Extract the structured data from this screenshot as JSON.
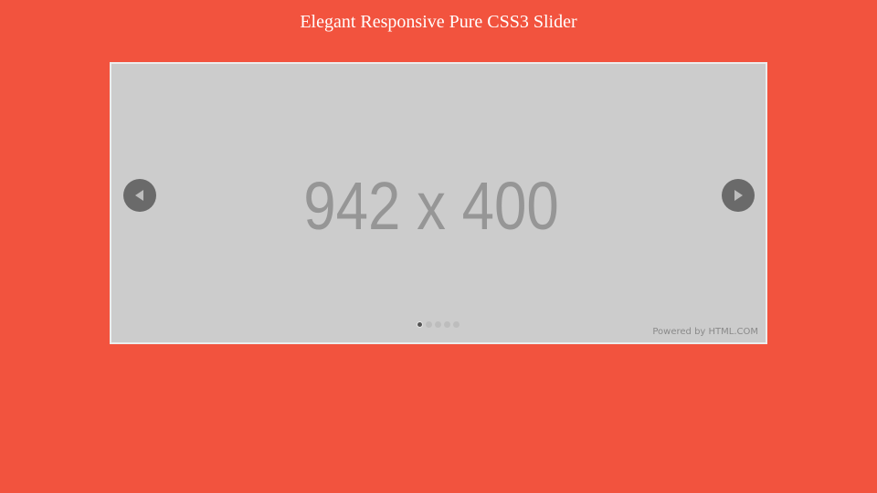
{
  "page": {
    "title": "Elegant Responsive Pure CSS3 Slider",
    "background_color": "#f2533e"
  },
  "slider": {
    "placeholder_text": "942 x 400",
    "placeholder_bg": "#cccccc",
    "prev_icon": "triangle-left-icon",
    "next_icon": "triangle-right-icon",
    "slide_count": 5,
    "active_slide": 1,
    "powered_by": "Powered by HTML.COM"
  }
}
